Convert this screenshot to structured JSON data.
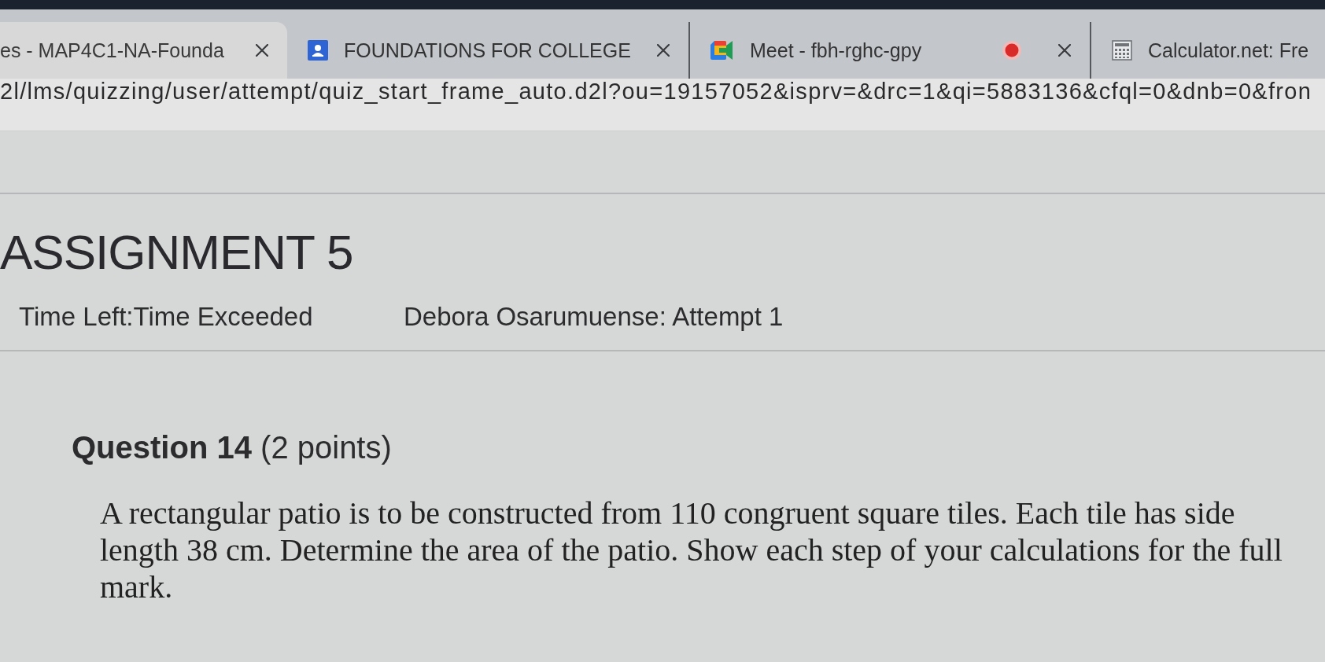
{
  "browser": {
    "tabs": [
      {
        "title": "es - MAP4C1-NA-Founda",
        "selected": true,
        "recording": false
      },
      {
        "title": "FOUNDATIONS FOR COLLEGE",
        "selected": false,
        "recording": false
      },
      {
        "title": "Meet - fbh-rghc-gpy",
        "selected": false,
        "recording": true
      },
      {
        "title": "Calculator.net: Fre",
        "selected": false,
        "recording": false
      }
    ],
    "address": "2l/lms/quizzing/user/attempt/quiz_start_frame_auto.d2l?ou=19157052&isprv=&drc=1&qi=5883136&cfql=0&dnb=0&fron"
  },
  "quiz": {
    "title": "ASSIGNMENT 5",
    "time_left": "Time Left:Time Exceeded",
    "attempt": "Debora Osarumuense: Attempt 1"
  },
  "question": {
    "heading": "**Question 14** (2 points)",
    "text": "A rectangular patio is to be constructed from 110 congruent square tiles. Each tile has side length 38 cm. Determine the area of the patio. Show each step of your calculations for the full mark."
  }
}
